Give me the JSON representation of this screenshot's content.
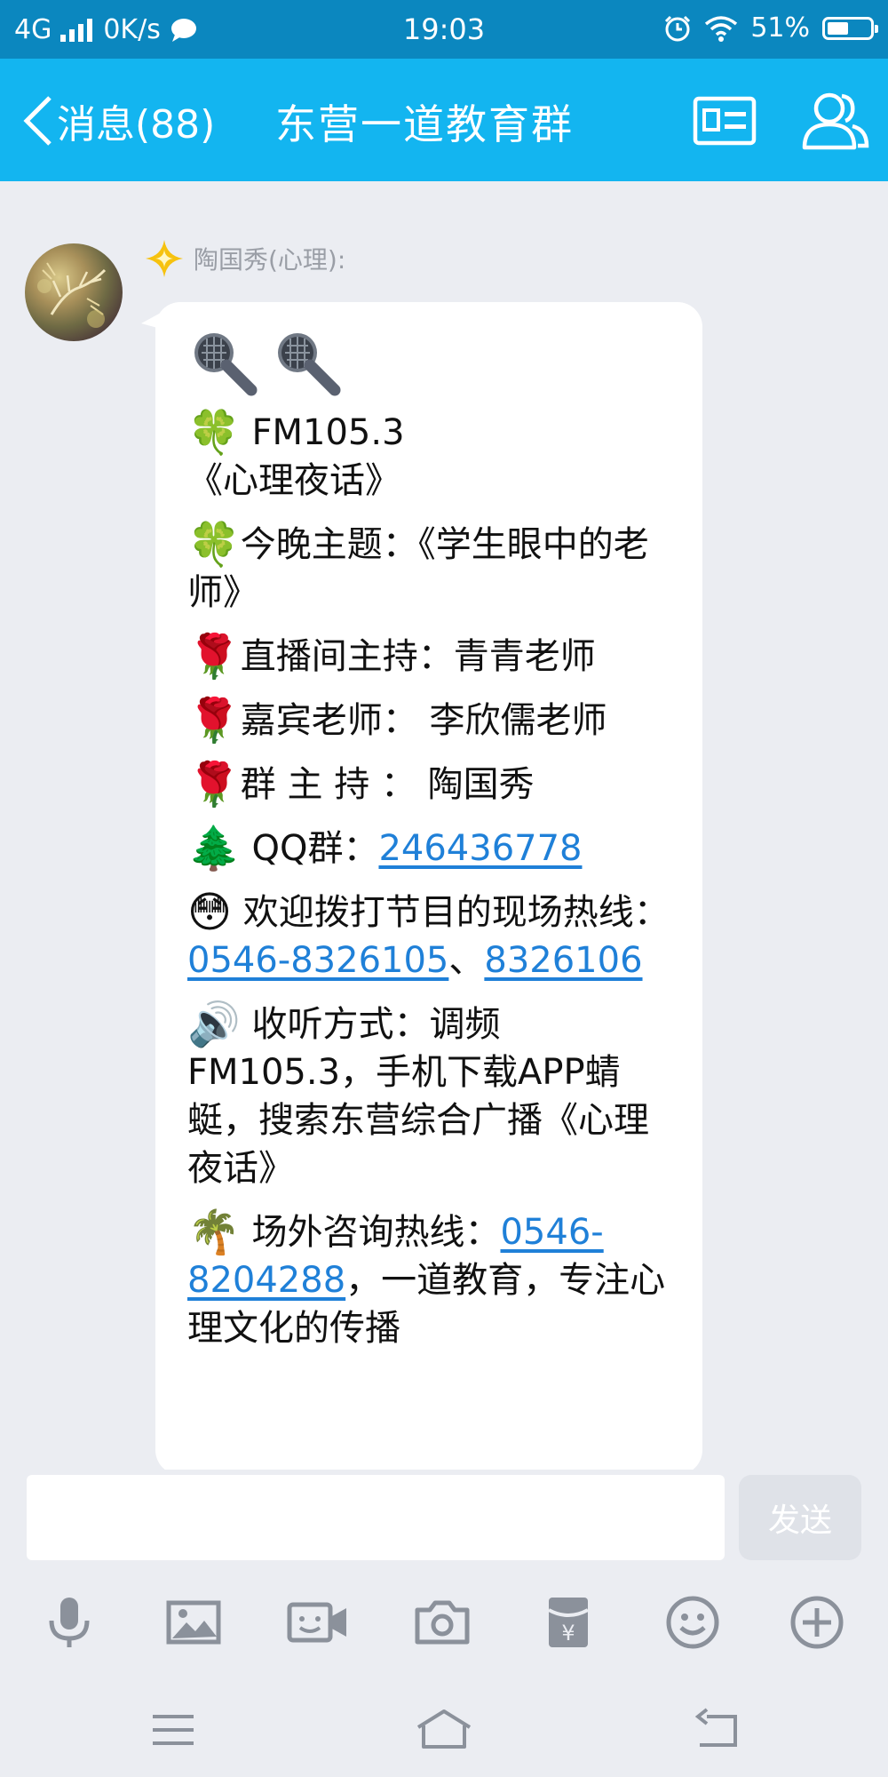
{
  "status_bar": {
    "network": "4G",
    "speed": "0K/s",
    "time": "19:03",
    "battery": "51%",
    "battery_level": 0.51
  },
  "header": {
    "back_label": "消息(88)",
    "title": "东营一道教育群"
  },
  "message": {
    "sender": "陶国秀(心理):",
    "lines": {
      "fm": "FM105.3",
      "program": "《心理夜话》",
      "topic": "今晚主题：《学生眼中的老师》",
      "host": "直播间主持：青青老师",
      "guest": "嘉宾老师：  李欣儒老师",
      "group_host": "群 主 持 ：   陶国秀",
      "qq_label": "QQ群：",
      "qq_number": "246436778",
      "hotline_text": "欢迎拨打节目的现场热线：",
      "hotline_1": "0546-8326105",
      "hotline_sep": "、",
      "hotline_2": "8326106",
      "listen": "收听方式：调频FM105.3，手机下载APP蜻蜓，搜索东营综合广播《心理夜话》",
      "consult_label": "场外咨询热线：",
      "consult_number": "0546-8204288",
      "consult_rest": "，一道教育，专注心理文化的传播"
    }
  },
  "input": {
    "value": "",
    "send_label": "发送"
  },
  "toolbar": [
    "microphone-icon",
    "image-icon",
    "video-call-icon",
    "camera-icon",
    "red-packet-icon",
    "emoji-icon",
    "plus-icon"
  ],
  "navbar": [
    "menu-icon",
    "home-icon",
    "back-icon"
  ],
  "colors": {
    "status_bar": "#0b87bf",
    "title_bar": "#13b5f0",
    "background": "#ebedf2",
    "link": "#1f80d8"
  }
}
